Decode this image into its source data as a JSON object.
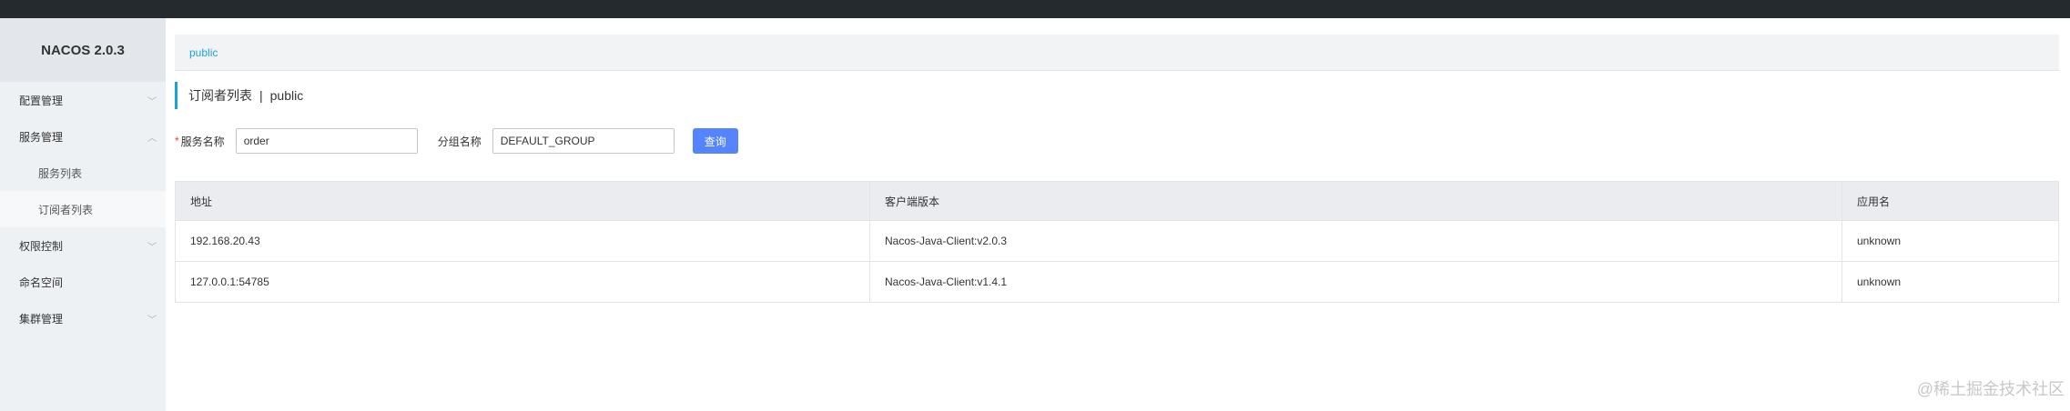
{
  "app": {
    "brand": "NACOS 2.0.3"
  },
  "sidebar": {
    "items": [
      {
        "label": "配置管理",
        "chevron": "﹀"
      },
      {
        "label": "服务管理",
        "chevron": "︿"
      },
      {
        "label": "服务列表"
      },
      {
        "label": "订阅者列表"
      },
      {
        "label": "权限控制",
        "chevron": "﹀"
      },
      {
        "label": "命名空间"
      },
      {
        "label": "集群管理",
        "chevron": "﹀"
      }
    ]
  },
  "breadcrumb": {
    "namespace": "public"
  },
  "page": {
    "title": "订阅者列表",
    "separator": "|",
    "namespace": "public"
  },
  "form": {
    "required_mark": "*",
    "service_label": "服务名称",
    "service_value": "order",
    "group_label": "分组名称",
    "group_value": "DEFAULT_GROUP",
    "query_button": "查询"
  },
  "table": {
    "headers": [
      "地址",
      "客户端版本",
      "应用名"
    ],
    "rows": [
      [
        "192.168.20.43",
        "Nacos-Java-Client:v2.0.3",
        "unknown"
      ],
      [
        "127.0.0.1:54785",
        "Nacos-Java-Client:v1.4.1",
        "unknown"
      ]
    ]
  },
  "watermark": "@稀土掘金技术社区"
}
